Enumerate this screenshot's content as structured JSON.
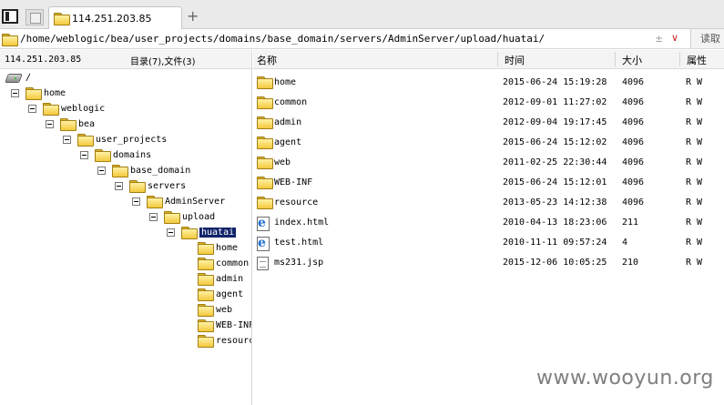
{
  "tabbar": {
    "tab_title": "114.251.203.85",
    "new_tab_glyph": "+"
  },
  "address": {
    "path": "/home/weblogic/bea/user_projects/domains/base_domain/servers/AdminServer/upload/huatai/",
    "sort_glyph": "±",
    "dropdown_glyph": "∨",
    "read_label": "读取"
  },
  "left": {
    "host": "114.251.203.85",
    "counts": "目录(7),文件(3)",
    "tree": {
      "root": "/",
      "home": "home",
      "weblogic": "weblogic",
      "bea": "bea",
      "user_projects": "user_projects",
      "domains": "domains",
      "base_domain": "base_domain",
      "servers": "servers",
      "adminserver": "AdminServer",
      "upload": "upload",
      "huatai": "huatai",
      "children": [
        "home",
        "common",
        "admin",
        "agent",
        "web",
        "WEB-INF",
        "resource"
      ]
    }
  },
  "right": {
    "columns": {
      "name": "名称",
      "time": "时间",
      "size": "大小",
      "attr": "属性"
    },
    "files": [
      {
        "icon": "folder-icon",
        "name": "home",
        "time": "2015-06-24 15:19:28",
        "size": "4096",
        "attr": "R W"
      },
      {
        "icon": "folder-icon",
        "name": "common",
        "time": "2012-09-01 11:27:02",
        "size": "4096",
        "attr": "R W"
      },
      {
        "icon": "folder-icon",
        "name": "admin",
        "time": "2012-09-04 19:17:45",
        "size": "4096",
        "attr": "R W"
      },
      {
        "icon": "folder-icon",
        "name": "agent",
        "time": "2015-06-24 15:12:02",
        "size": "4096",
        "attr": "R W"
      },
      {
        "icon": "folder-icon",
        "name": "web",
        "time": "2011-02-25 22:30:44",
        "size": "4096",
        "attr": "R W"
      },
      {
        "icon": "folder-icon",
        "name": "WEB-INF",
        "time": "2015-06-24 15:12:01",
        "size": "4096",
        "attr": "R W"
      },
      {
        "icon": "folder-icon",
        "name": "resource",
        "time": "2013-05-23 14:12:38",
        "size": "4096",
        "attr": "R W"
      },
      {
        "icon": "html-file-icon",
        "name": "index.html",
        "time": "2010-04-13 18:23:06",
        "size": "211",
        "attr": "R W"
      },
      {
        "icon": "html-file-icon",
        "name": "test.html",
        "time": "2010-11-11 09:57:24",
        "size": "4",
        "attr": "R W"
      },
      {
        "icon": "file-icon",
        "name": "ms231.jsp",
        "time": "2015-12-06 10:05:25",
        "size": "210",
        "attr": "R W"
      }
    ]
  },
  "watermark": "www.wooyun.org"
}
